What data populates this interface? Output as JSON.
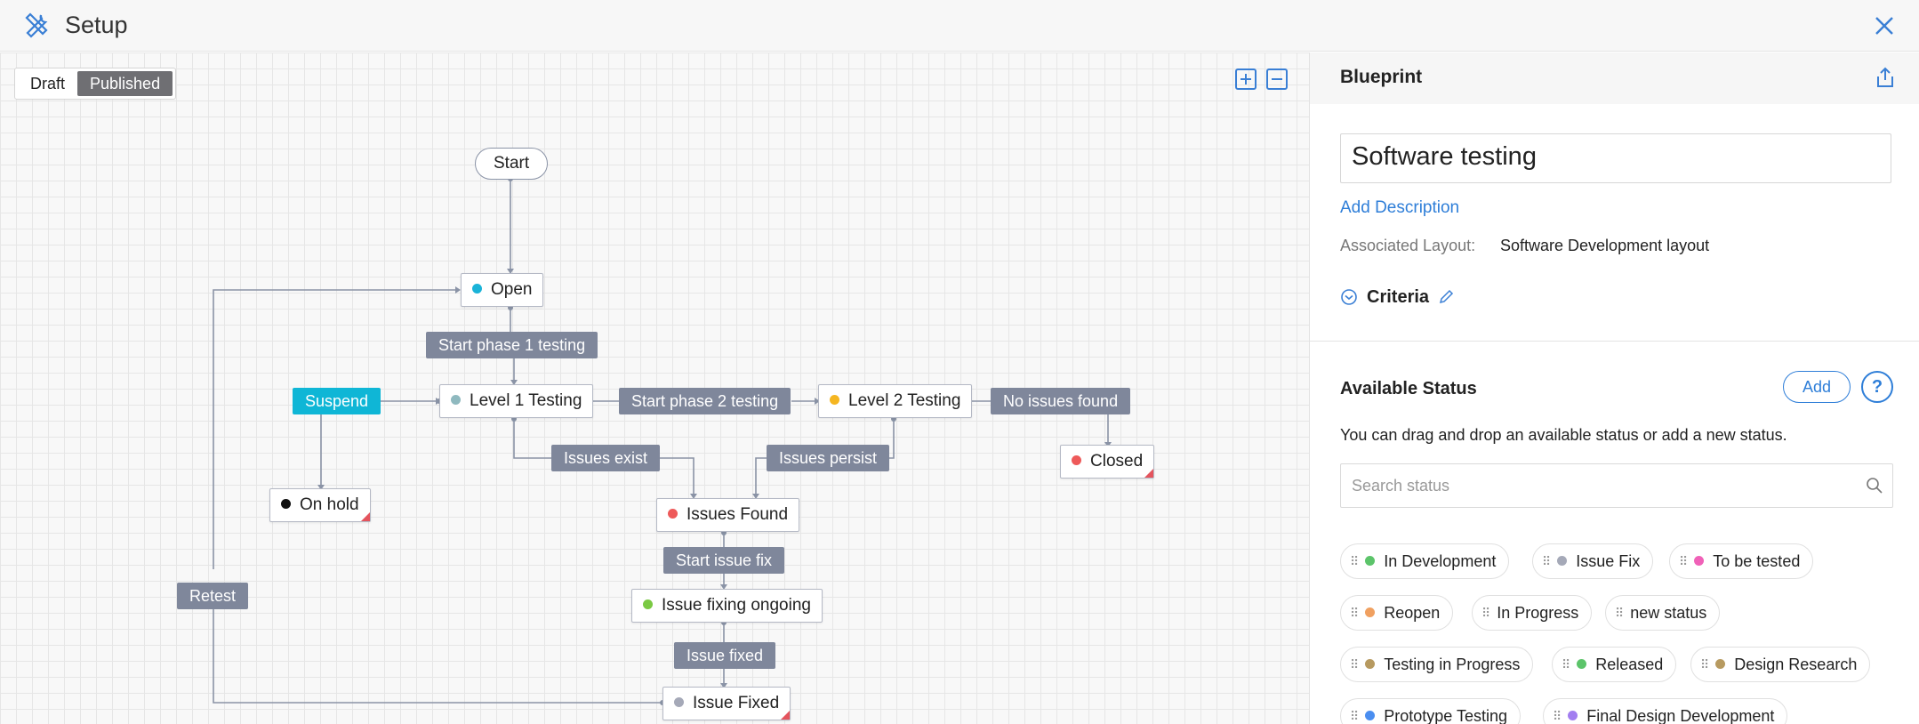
{
  "app": {
    "title": "Setup"
  },
  "toggle": {
    "draft": "Draft",
    "published": "Published"
  },
  "flow": {
    "start": "Start",
    "nodes": {
      "open": "Open",
      "level1": "Level 1 Testing",
      "level2": "Level 2 Testing",
      "closed": "Closed",
      "onhold": "On hold",
      "issues_found": "Issues Found",
      "issue_fixing": "Issue fixing ongoing",
      "issue_fixed": "Issue Fixed"
    },
    "transitions": {
      "start_phase1": "Start phase 1 testing",
      "start_phase2": "Start phase 2 testing",
      "no_issues": "No issues found",
      "suspend": "Suspend",
      "issues_exist": "Issues exist",
      "issues_persist": "Issues persist",
      "start_fix": "Start issue fix",
      "issue_fixed": "Issue fixed",
      "retest": "Retest"
    },
    "colors": {
      "open": "#1ab3d8",
      "level1": "#8fb9bf",
      "level2": "#f5b621",
      "closed": "#ee5a5a",
      "onhold": "#111111",
      "issues_found": "#ee5a5a",
      "issue_fixing": "#7ac943",
      "issue_fixed": "#a5a9b8"
    }
  },
  "panel": {
    "title": "Blueprint",
    "blueprint_name": "Software testing",
    "add_description": "Add Description",
    "associated_layout_label": "Associated Layout:",
    "associated_layout_value": "Software Development layout",
    "criteria": "Criteria",
    "available_status_title": "Available Status",
    "add_button": "Add",
    "help": "?",
    "description": "You can drag and drop an available status or add a new status.",
    "search_placeholder": "Search status",
    "statuses": [
      {
        "label": "In Development",
        "color": "#5cc46a"
      },
      {
        "label": "Issue Fix",
        "color": "#a5a9b8"
      },
      {
        "label": "To be tested",
        "color": "#f061b8"
      },
      {
        "label": "Reopen",
        "color": "#f0a060"
      },
      {
        "label": "In Progress",
        "color": ""
      },
      {
        "label": "new status",
        "color": ""
      },
      {
        "label": "Testing in Progress",
        "color": "#b79a60"
      },
      {
        "label": "Released",
        "color": "#5cc46a"
      },
      {
        "label": "Design Research",
        "color": "#b79a60"
      },
      {
        "label": "Prototype Testing",
        "color": "#4a8ef0"
      },
      {
        "label": "Final Design Development",
        "color": "#a27ef0"
      }
    ]
  }
}
